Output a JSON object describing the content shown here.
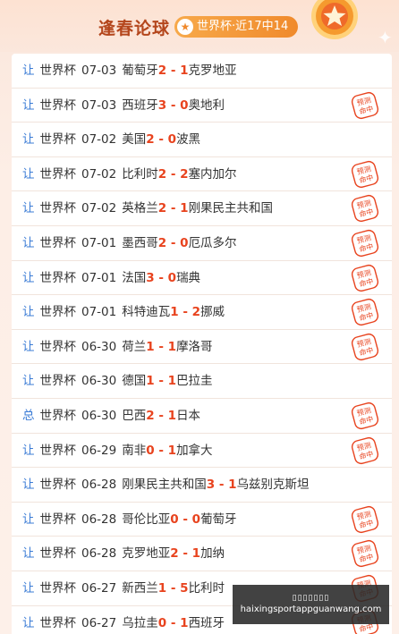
{
  "header": {
    "title": "逢春论球",
    "record": "世界杯·近17中14"
  },
  "rows": [
    {
      "tag": "让",
      "league": "世界杯",
      "date": "07-03",
      "home": "葡萄牙",
      "hs": "2",
      "sep": "-",
      "as": "1",
      "away": "克罗地亚",
      "hit": false
    },
    {
      "tag": "让",
      "league": "世界杯",
      "date": "07-03",
      "home": "西班牙",
      "hs": "3",
      "sep": "-",
      "as": "0",
      "away": "奥地利",
      "hit": true
    },
    {
      "tag": "让",
      "league": "世界杯",
      "date": "07-02",
      "home": "美国",
      "hs": "2",
      "sep": "-",
      "as": "0",
      "away": "波黑",
      "hit": false
    },
    {
      "tag": "让",
      "league": "世界杯",
      "date": "07-02",
      "home": "比利时",
      "hs": "2",
      "sep": "-",
      "as": "2",
      "away": "塞内加尔",
      "hit": true
    },
    {
      "tag": "让",
      "league": "世界杯",
      "date": "07-02",
      "home": "英格兰",
      "hs": "2",
      "sep": "-",
      "as": "1",
      "away": "刚果民主共和国",
      "hit": true
    },
    {
      "tag": "让",
      "league": "世界杯",
      "date": "07-01",
      "home": "墨西哥",
      "hs": "2",
      "sep": "-",
      "as": "0",
      "away": "厄瓜多尔",
      "hit": true
    },
    {
      "tag": "让",
      "league": "世界杯",
      "date": "07-01",
      "home": "法国",
      "hs": "3",
      "sep": "-",
      "as": "0",
      "away": "瑞典",
      "hit": true
    },
    {
      "tag": "让",
      "league": "世界杯",
      "date": "07-01",
      "home": "科特迪瓦",
      "hs": "1",
      "sep": "-",
      "as": "2",
      "away": "挪威",
      "hit": true
    },
    {
      "tag": "让",
      "league": "世界杯",
      "date": "06-30",
      "home": "荷兰",
      "hs": "1",
      "sep": "-",
      "as": "1",
      "away": "摩洛哥",
      "hit": true
    },
    {
      "tag": "让",
      "league": "世界杯",
      "date": "06-30",
      "home": "德国",
      "hs": "1",
      "sep": "-",
      "as": "1",
      "away": "巴拉圭",
      "hit": false
    },
    {
      "tag": "总",
      "league": "世界杯",
      "date": "06-30",
      "home": "巴西",
      "hs": "2",
      "sep": "-",
      "as": "1",
      "away": "日本",
      "hit": true
    },
    {
      "tag": "让",
      "league": "世界杯",
      "date": "06-29",
      "home": "南非",
      "hs": "0",
      "sep": "-",
      "as": "1",
      "away": "加拿大",
      "hit": true
    },
    {
      "tag": "让",
      "league": "世界杯",
      "date": "06-28",
      "home": "刚果民主共和国",
      "hs": "3",
      "sep": "-",
      "as": "1",
      "away": "乌兹别克斯坦",
      "hit": false
    },
    {
      "tag": "让",
      "league": "世界杯",
      "date": "06-28",
      "home": "哥伦比亚",
      "hs": "0",
      "sep": "-",
      "as": "0",
      "away": "葡萄牙",
      "hit": true
    },
    {
      "tag": "让",
      "league": "世界杯",
      "date": "06-28",
      "home": "克罗地亚",
      "hs": "2",
      "sep": "-",
      "as": "1",
      "away": "加纳",
      "hit": true
    },
    {
      "tag": "让",
      "league": "世界杯",
      "date": "06-27",
      "home": "新西兰",
      "hs": "1",
      "sep": "-",
      "as": "5",
      "away": "比利时",
      "hit": true
    },
    {
      "tag": "让",
      "league": "世界杯",
      "date": "06-27",
      "home": "乌拉圭",
      "hs": "0",
      "sep": "-",
      "as": "1",
      "away": "西班牙",
      "hit": true
    }
  ],
  "stamp": {
    "line1": "预测",
    "line2": "命中",
    "color": "#e8431e"
  },
  "watermark": {
    "line1": "▯▯▯▯▯▯▯",
    "line2": "haixingsportappguanwang.com"
  },
  "colors": {
    "accent": "#e8431e",
    "tag": "#3a7bd5",
    "title": "#b4461c",
    "pill": "#f08a2c"
  }
}
